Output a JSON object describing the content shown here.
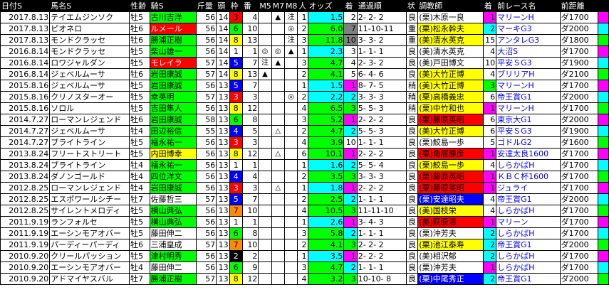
{
  "headers": [
    "日付S",
    "馬名S",
    "性齢",
    "騎S",
    "斤量",
    "頭",
    "枠",
    "番",
    "M5",
    "M7",
    "M8",
    "人",
    "オッズ",
    "着",
    "通過順",
    "状",
    "調教師",
    "着",
    "前レース名",
    "前距離",
    ""
  ],
  "rows": [
    {
      "date": "2017.8.13",
      "horse": "テイエムジンソク",
      "sex": "牡5",
      "jockey": "古川吉洋",
      "jbg": "#00ff00",
      "jfg": "#000",
      "wt": "56",
      "n": "14",
      "gate": "3",
      "gbg": "#ff0000",
      "gfg": "#000",
      "num": "4",
      "m5": "",
      "m7": "▲",
      "m8": "注",
      "pop": "1",
      "odds": "1.5",
      "obg": "#00ffff",
      "fin": "2",
      "fbg": "#fff",
      "pass": "2- 2- 2",
      "cond": "良",
      "trainer": "(栗)木原一良",
      "tbg": "#fff",
      "tfg": "#000",
      "pfin": "1",
      "pfbg": "#ff00ff",
      "prace": "マリーンH",
      "prfg": "#0000ff",
      "dist": "ダ1700",
      "dflag": "1"
    },
    {
      "date": "2017.8.13",
      "horse": "ピオネロ",
      "sex": "牡6",
      "jockey": "ルメール",
      "jbg": "#ff0000",
      "jfg": "#fff",
      "wt": "56",
      "n": "14",
      "gate": "6",
      "gbg": "#00ff00",
      "gfg": "#000",
      "num": "10",
      "m5": "",
      "m7": "",
      "m8": "◎",
      "pop": "2",
      "odds": "6.0",
      "obg": "#00ff00",
      "fin": "7",
      "fbg": "#808080",
      "pass": "11-10-11",
      "cond": "重",
      "trainer": "(栗)松永幹夫",
      "tbg": "#ffff00",
      "tfg": "#000",
      "pfin": "2",
      "pfbg": "#00ffff",
      "prace": "マーキG3",
      "prfg": "#0000ff",
      "dist": "ダ2000",
      "dflag": "2"
    },
    {
      "date": "2017.8.13",
      "horse": "モンドクラッセ",
      "sex": "牡6",
      "jockey": "勝浦正樹",
      "jbg": "#00ff00",
      "jfg": "#000",
      "wt": "56",
      "n": "14",
      "gate": "8",
      "gbg": "#ffff00",
      "gfg": "#000",
      "num": "13",
      "m5": "",
      "m7": "",
      "m8": "注",
      "pop": "3",
      "odds": "11.8",
      "obg": "#00ff00",
      "fin": "10",
      "fbg": "#808080",
      "pass": "3- 3- 2",
      "cond": "重",
      "trainer": "(美)清水英克",
      "tbg": "#ffff00",
      "tfg": "#000",
      "pfin": "15",
      "pfbg": "#fff",
      "prace": "アンタレG3",
      "prfg": "#0000ff",
      "dist": "ダ1800",
      "dflag": "3"
    },
    {
      "date": "2016.8.14",
      "horse": "モンドクラッセ",
      "sex": "牡5",
      "jockey": "柴山雄一",
      "jbg": "#00ff00",
      "jfg": "#000",
      "wt": "56",
      "n": "14",
      "gate": "1",
      "gbg": "#fff",
      "gfg": "#000",
      "num": "1",
      "m5": "◎",
      "m7": "◎",
      "m8": "▲",
      "pop": "1",
      "odds": "2.3",
      "obg": "#00ffff",
      "fin": "3",
      "fbg": "#fff",
      "pass": "1- 1- 1",
      "cond": "良",
      "trainer": "(美)清水英克",
      "tbg": "#fff",
      "tfg": "#000",
      "pfin": "4",
      "pfbg": "#fff",
      "prace": "大沼S",
      "prfg": "#0000ff",
      "dist": "ダ1700",
      "dflag": "1"
    },
    {
      "date": "2016.8.14",
      "horse": "ロワジャルダン",
      "sex": "牡5",
      "jockey": "モレイラ",
      "jbg": "#ff0000",
      "jfg": "#fff",
      "wt": "57",
      "n": "14",
      "gate": "5",
      "gbg": "#0000ff",
      "gfg": "#fff",
      "num": "7",
      "m5": "注",
      "m7": "▲",
      "m8": "",
      "pop": "3",
      "odds": "4.7",
      "obg": "#00ff00",
      "fin": "4",
      "fbg": "#fff",
      "pass": "2- 3- 2",
      "cond": "良",
      "trainer": "(美)戸田博文",
      "tbg": "#fff",
      "tfg": "#000",
      "pfin": "10",
      "pfbg": "#fff",
      "prace": "平安ＳG3",
      "prfg": "#0000ff",
      "dist": "ダ1900",
      "dflag": "2"
    },
    {
      "date": "2016.8.14",
      "horse": "ジェベルムーサ",
      "sex": "牡6",
      "jockey": "岩田康誠",
      "jbg": "#00ff00",
      "jfg": "#000",
      "wt": "57",
      "n": "14",
      "gate": "8",
      "gbg": "#ffff00",
      "gfg": "#000",
      "num": "13",
      "m5": "▲",
      "m7": "",
      "m8": "",
      "pop": "2",
      "odds": "4.1",
      "obg": "#00ff00",
      "fin": "5",
      "fbg": "#fff",
      "pass": "6- 4- 6",
      "cond": "良",
      "trainer": "(美)大竹正博",
      "tbg": "#ffff00",
      "tfg": "#000",
      "pfin": "4",
      "pfbg": "#fff",
      "prace": "ブリリアH",
      "prfg": "#0000ff",
      "dist": "ダ2100",
      "dflag": "3"
    },
    {
      "date": "2015.8.16",
      "horse": "ジェベルムーサ",
      "sex": "牡5",
      "jockey": "岩田康誠",
      "jbg": "#00ff00",
      "jfg": "#000",
      "wt": "56",
      "n": "13",
      "gate": "5",
      "gbg": "#0000ff",
      "gfg": "#fff",
      "num": "7",
      "m5": "",
      "m7": "",
      "m8": "",
      "pop": "1",
      "odds": "1.5",
      "obg": "#00ffff",
      "fin": "1",
      "fbg": "#ff00ff",
      "pass": "8- 7- 5",
      "cond": "稍",
      "trainer": "(美)大竹正博",
      "tbg": "#ffff00",
      "tfg": "#000",
      "pfin": "3",
      "pfbg": "#00ff00",
      "prace": "マリーンH",
      "prfg": "#0000ff",
      "dist": "ダ1700",
      "dflag": "1"
    },
    {
      "date": "2015.8.16",
      "horse": "クリノスターオー",
      "sex": "牡5",
      "jockey": "幸英明",
      "jbg": "#00ff00",
      "jfg": "#000",
      "wt": "57",
      "n": "13",
      "gate": "3",
      "gbg": "#ff0000",
      "gfg": "#fff",
      "num": "3",
      "m5": "",
      "m7": "",
      "m8": "◎",
      "pop": "2",
      "odds": "2.2",
      "obg": "#00ffff",
      "fin": "2",
      "fbg": "#00ffff",
      "pass": "3- 3- 3",
      "cond": "稍",
      "trainer": "(栗)高橋義忠",
      "tbg": "#ffff00",
      "tfg": "#000",
      "pfin": "6",
      "pfbg": "#fff",
      "prace": "帝王賞G1",
      "prfg": "#0000ff",
      "dist": "ダ2000",
      "dflag": "2"
    },
    {
      "date": "2015.8.16",
      "horse": "ソロル",
      "sex": "牡5",
      "jockey": "吉田隼人",
      "jbg": "#00ff00",
      "jfg": "#000",
      "wt": "56",
      "n": "13",
      "gate": "8",
      "gbg": "#ffff00",
      "gfg": "#000",
      "num": "12",
      "m5": "",
      "m7": "",
      "m8": "",
      "pop": "4",
      "odds": "6.5",
      "obg": "#00ff00",
      "fin": "3",
      "fbg": "#00ff00",
      "pass": "5- 5- 3",
      "cond": "稍",
      "trainer": "(栗)中竹和也",
      "tbg": "#ffff00",
      "tfg": "#000",
      "pfin": "1",
      "pfbg": "#ff00ff",
      "prace": "マリーンH",
      "prfg": "#0000ff",
      "dist": "ダ1700",
      "dflag": "3"
    },
    {
      "date": "2014.7.27",
      "horse": "ローマンレジェンド",
      "sex": "牡6",
      "jockey": "岩田康誠",
      "jbg": "#00ff00",
      "jfg": "#000",
      "wt": "58",
      "n": "13",
      "gate": "6",
      "gbg": "#00ff00",
      "gfg": "#000",
      "num": "8",
      "m5": "",
      "m7": "",
      "m8": "",
      "pop": "3",
      "odds": "5.2",
      "obg": "#00ff00",
      "fin": "1",
      "fbg": "#ff00ff",
      "pass": "2- 2- 2",
      "cond": "良",
      "trainer": "(栗)藤原英昭",
      "tbg": "#ff0000",
      "tfg": "#000",
      "pfin": "6",
      "pfbg": "#fff",
      "prace": "東京大G1",
      "prfg": "#0000ff",
      "dist": "ダ2000",
      "dflag": "1"
    },
    {
      "date": "2014.7.27",
      "horse": "ジェベルムーサ",
      "sex": "牡4",
      "jockey": "田辺裕信",
      "jbg": "#00ff00",
      "jfg": "#000",
      "wt": "55",
      "n": "13",
      "gate": "4",
      "gbg": "#0000ff",
      "gfg": "#fff",
      "num": "5",
      "m5": "",
      "m7": "△",
      "m8": "",
      "pop": "2",
      "odds": "4.7",
      "obg": "#00ff00",
      "fin": "2",
      "fbg": "#00ffff",
      "pass": "5- 5- 3",
      "cond": "良",
      "trainer": "(美)大竹正博",
      "tbg": "#ffff00",
      "tfg": "#000",
      "pfin": "6",
      "pfbg": "#fff",
      "prace": "平安ＳG3",
      "prfg": "#0000ff",
      "dist": "ダ1900",
      "dflag": "2"
    },
    {
      "date": "2014.7.27",
      "horse": "ブライトライン",
      "sex": "牡5",
      "jockey": "福永祐一",
      "jbg": "#00ff00",
      "jfg": "#000",
      "wt": "56",
      "n": "13",
      "gate": "3",
      "gbg": "#ff0000",
      "gfg": "#fff",
      "num": "3",
      "m5": "",
      "m7": "",
      "m8": "",
      "pop": "4",
      "odds": "3.9",
      "obg": "#00ff00",
      "fin": "10",
      "fbg": "#fff",
      "pass": "1- 1- 1",
      "cond": "良",
      "trainer": "(栗)鮫島一歩",
      "tbg": "#fff",
      "tfg": "#000",
      "pfin": "5",
      "pfbg": "#fff",
      "prace": "ゴドルG2",
      "prfg": "#0000ff",
      "dist": "ダ1600",
      "dflag": "3"
    },
    {
      "date": "2013.8.24",
      "horse": "フリートストリート",
      "sex": "牡5",
      "jockey": "内田博幸",
      "jbg": "#ffff00",
      "jfg": "#000",
      "wt": "56",
      "n": "13",
      "gate": "8",
      "gbg": "#ffff00",
      "gfg": "#000",
      "num": "12",
      "m5": "",
      "m7": "△",
      "m8": "",
      "pop": "6",
      "odds": "10.1",
      "obg": "#00ff00",
      "fin": "1",
      "fbg": "#ff00ff",
      "pass": "2- 2- 2",
      "cond": "良",
      "trainer": "(栗)角居勝彦",
      "tbg": "#ff0000",
      "tfg": "#000",
      "pfin": "1",
      "pfbg": "#ff00ff",
      "prace": "安達太良1600",
      "prfg": "#0000ff",
      "dist": "ダ1700",
      "dflag": "1"
    },
    {
      "date": "2013.8.24",
      "horse": "ブライトライン",
      "sex": "牡4",
      "jockey": "福永祐一",
      "jbg": "#00ff00",
      "jfg": "#000",
      "wt": "56",
      "n": "13",
      "gate": "1",
      "gbg": "#fff",
      "gfg": "#000",
      "num": "1",
      "m5": "",
      "m7": "",
      "m8": "",
      "pop": "1",
      "odds": "1.6",
      "obg": "#00ffff",
      "fin": "2",
      "fbg": "#00ffff",
      "pass": "5- 5- 4",
      "cond": "良",
      "trainer": "(栗)鮫島一歩",
      "tbg": "#ffff00",
      "tfg": "#000",
      "pfin": "4",
      "pfbg": "#fff",
      "prace": "しらかばH",
      "prfg": "#0000ff",
      "dist": "ダ1700",
      "dflag": "2"
    },
    {
      "date": "2013.8.24",
      "horse": "ダノンゴールド",
      "sex": "牡4",
      "jockey": "四位洋文",
      "jbg": "#00ff00",
      "jfg": "#000",
      "wt": "56",
      "n": "13",
      "gate": "4",
      "gbg": "#0000ff",
      "gfg": "#fff",
      "num": "4",
      "m5": "",
      "m7": "",
      "m8": "",
      "pop": "2",
      "odds": "3.5",
      "obg": "#00ff00",
      "fin": "3",
      "fbg": "#00ff00",
      "pass": "3- 3- 3",
      "cond": "良",
      "trainer": "(栗)藤原英昭",
      "tbg": "#ff0000",
      "tfg": "#000",
      "pfin": "1",
      "pfbg": "#ff00ff",
      "prace": "ＫＢＣ杯1600",
      "prfg": "#0000ff",
      "dist": "ダ1700",
      "dflag": "3"
    },
    {
      "date": "2012.8.25",
      "horse": "ローマンレジェンド",
      "sex": "牡4",
      "jockey": "岩田康誠",
      "jbg": "#00ff00",
      "jfg": "#000",
      "wt": "56",
      "n": "13",
      "gate": "3",
      "gbg": "#ff0000",
      "gfg": "#fff",
      "num": "3",
      "m5": "",
      "m7": "△",
      "m8": "",
      "pop": "1",
      "odds": "1.8",
      "obg": "#00ffff",
      "fin": "1",
      "fbg": "#ff00ff",
      "pass": "2- 2- 2",
      "cond": "良",
      "trainer": "(栗)藤原英昭",
      "tbg": "#ff0000",
      "tfg": "#000",
      "pfin": "1",
      "pfbg": "#ff00ff",
      "prace": "ジュライ",
      "prfg": "#0000ff",
      "dist": "ダ1700",
      "dflag": "1"
    },
    {
      "date": "2012.8.25",
      "horse": "エスポワールシチー",
      "sex": "牡7",
      "jockey": "佐藤哲三",
      "jbg": "#fff",
      "jfg": "#000",
      "wt": "57",
      "n": "13",
      "gate": "5",
      "gbg": "#0000ff",
      "gfg": "#fff",
      "num": "7",
      "m5": "",
      "m7": "",
      "m8": "",
      "pop": "2",
      "odds": "2.5",
      "obg": "#00ff00",
      "fin": "2",
      "fbg": "#00ffff",
      "pass": "1- 1- 1",
      "cond": "良",
      "trainer": "(栗)安達昭夫",
      "tbg": "#0000ff",
      "tfg": "#fff",
      "pfin": "4",
      "pfbg": "#fff",
      "prace": "帝王賞G1",
      "prfg": "#0000ff",
      "dist": "ダ2000",
      "dflag": "2"
    },
    {
      "date": "2012.8.25",
      "horse": "サイレントメロディ",
      "sex": "牡5",
      "jockey": "横山典弘",
      "jbg": "#00ff00",
      "jfg": "#000",
      "wt": "56",
      "n": "13",
      "gate": "7",
      "gbg": "#ff8c00",
      "gfg": "#000",
      "num": "10",
      "m5": "",
      "m7": "",
      "m8": "",
      "pop": "4",
      "odds": "10.5",
      "obg": "#00ff00",
      "fin": "3",
      "fbg": "#00ff00",
      "pass": "11-11-10",
      "cond": "良",
      "trainer": "(美)国枝栄",
      "tbg": "#ffff00",
      "tfg": "#000",
      "pfin": "4",
      "pfbg": "#fff",
      "prace": "しらかばH",
      "prfg": "#0000ff",
      "dist": "ダ1700",
      "dflag": "3"
    },
    {
      "date": "2011.9.19",
      "horse": "ランフォルセ",
      "sex": "牡5",
      "jockey": "横山典弘",
      "jbg": "#00ff00",
      "jfg": "#000",
      "wt": "56",
      "n": "13",
      "gate": "1",
      "gbg": "#fff",
      "gfg": "#000",
      "num": "1",
      "m5": "",
      "m7": "",
      "m8": "",
      "pop": "1",
      "odds": "2.6",
      "obg": "#00ffff",
      "fin": "1",
      "fbg": "#ff00ff",
      "pass": "3- 4- 3",
      "cond": "良",
      "trainer": "(美)萩原清",
      "tbg": "#ff0000",
      "tfg": "#000",
      "pfin": "1",
      "pfbg": "#ff00ff",
      "prace": "マリーン",
      "prfg": "#0000ff",
      "dist": "ダ1700",
      "dflag": "1"
    },
    {
      "date": "2011.9.19",
      "horse": "エーシンモアオバー",
      "sex": "牡5",
      "jockey": "藤田伸二",
      "jbg": "#fff",
      "jfg": "#000",
      "wt": "56",
      "n": "13",
      "gate": "6",
      "gbg": "#00ff00",
      "gfg": "#000",
      "num": "8",
      "m5": "",
      "m7": "",
      "m8": "",
      "pop": "3",
      "odds": "5.8",
      "obg": "#00ff00",
      "fin": "2",
      "fbg": "#00ffff",
      "pass": "1- 1- 1",
      "cond": "良",
      "trainer": "(栗)沖芳夫",
      "tbg": "#fff",
      "tfg": "#000",
      "pfin": "2",
      "pfbg": "#00ffff",
      "prace": "しらかばH",
      "prfg": "#0000ff",
      "dist": "ダ1700",
      "dflag": "2"
    },
    {
      "date": "2011.9.19",
      "horse": "パーディーパーディ",
      "sex": "牡6",
      "jockey": "三浦皇成",
      "jbg": "#fff",
      "jfg": "#000",
      "wt": "57",
      "n": "13",
      "gate": "7",
      "gbg": "#ff8c00",
      "gfg": "#000",
      "num": "10",
      "m5": "",
      "m7": "",
      "m8": "",
      "pop": "2",
      "odds": "4.1",
      "obg": "#00ff00",
      "fin": "3",
      "fbg": "#00ff00",
      "pass": "2- 2- 2",
      "cond": "良",
      "trainer": "(栗)池江泰寿",
      "tbg": "#ffff00",
      "tfg": "#000",
      "pfin": "2",
      "pfbg": "#00ffff",
      "prace": "帝王賞G1",
      "prfg": "#0000ff",
      "dist": "ダ2000",
      "dflag": "3"
    },
    {
      "date": "2010.9.20",
      "horse": "クリールパッション",
      "sex": "牡5",
      "jockey": "津村明秀",
      "jbg": "#00ff00",
      "jfg": "#000",
      "wt": "56",
      "n": "13",
      "gate": "2",
      "gbg": "#000",
      "gfg": "#fff",
      "num": "2",
      "m5": "",
      "m7": "",
      "m8": "",
      "pop": "1",
      "odds": "3.5",
      "obg": "#00ffff",
      "fin": "1",
      "fbg": "#ff00ff",
      "pass": "2- 2- 2",
      "cond": "良",
      "trainer": "(美)相沢郁",
      "tbg": "#fff",
      "tfg": "#000",
      "pfin": "2",
      "pfbg": "#00ffff",
      "prace": "しらかばH",
      "prfg": "#0000ff",
      "dist": "ダ1700",
      "dflag": "1"
    },
    {
      "date": "2010.9.20",
      "horse": "エーシンモアオバー",
      "sex": "牡4",
      "jockey": "藤田伸二",
      "jbg": "#fff",
      "jfg": "#000",
      "wt": "56",
      "n": "13",
      "gate": "6",
      "gbg": "#00ff00",
      "gfg": "#000",
      "num": "9",
      "m5": "",
      "m7": "",
      "m8": "",
      "pop": "3",
      "odds": "4.7",
      "obg": "#00ff00",
      "fin": "2",
      "fbg": "#00ffff",
      "pass": "1- 1- 1",
      "cond": "良",
      "trainer": "(栗)沖芳夫",
      "tbg": "#fff",
      "tfg": "#000",
      "pfin": "1",
      "pfbg": "#ff00ff",
      "prace": "しらかばH",
      "prfg": "#0000ff",
      "dist": "ダ1700",
      "dflag": "2"
    },
    {
      "date": "2010.9.20",
      "horse": "アドマイヤスバル",
      "sex": "牡7",
      "jockey": "勝浦正樹",
      "jbg": "#00ff00",
      "jfg": "#000",
      "wt": "57",
      "n": "13",
      "gate": "8",
      "gbg": "#ffff00",
      "gfg": "#000",
      "num": "12",
      "m5": "",
      "m7": "",
      "m8": "",
      "pop": "4",
      "odds": "3.2",
      "obg": "#00ff00",
      "fin": "3",
      "fbg": "#00ff00",
      "pass": "10-10- 8",
      "cond": "良",
      "trainer": "(栗)中尾秀正",
      "tbg": "#0000ff",
      "tfg": "#fff",
      "pfin": "2",
      "pfbg": "#00ffff",
      "prace": "帝王賞G1",
      "prfg": "#0000ff",
      "dist": "ダ2000",
      "dflag": "3"
    }
  ]
}
